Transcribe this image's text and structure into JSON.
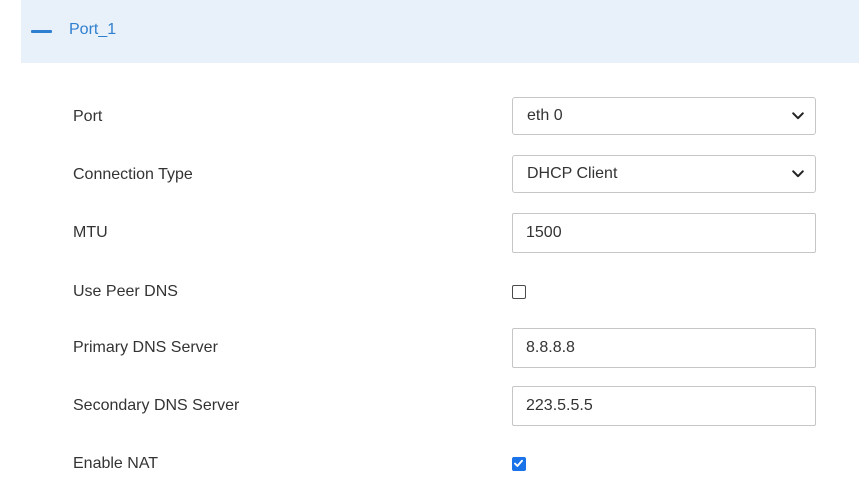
{
  "section": {
    "title": "Port_1"
  },
  "form": {
    "port": {
      "label": "Port",
      "value": "eth 0"
    },
    "connection_type": {
      "label": "Connection Type",
      "value": "DHCP Client"
    },
    "mtu": {
      "label": "MTU",
      "value": "1500"
    },
    "use_peer_dns": {
      "label": "Use Peer DNS",
      "checked": false
    },
    "primary_dns": {
      "label": "Primary DNS Server",
      "value": "8.8.8.8"
    },
    "secondary_dns": {
      "label": "Secondary DNS Server",
      "value": "223.5.5.5"
    },
    "enable_nat": {
      "label": "Enable NAT",
      "checked": true
    }
  },
  "colors": {
    "accent": "#2f7fd0",
    "header_bg": "#e8f1fa",
    "checkbox_checked": "#1a73e8",
    "border": "#c6c6c6",
    "text": "#333333"
  },
  "icons": {
    "collapse": "minus-icon",
    "dropdown": "chevron-down-icon",
    "check": "checkmark-icon"
  }
}
